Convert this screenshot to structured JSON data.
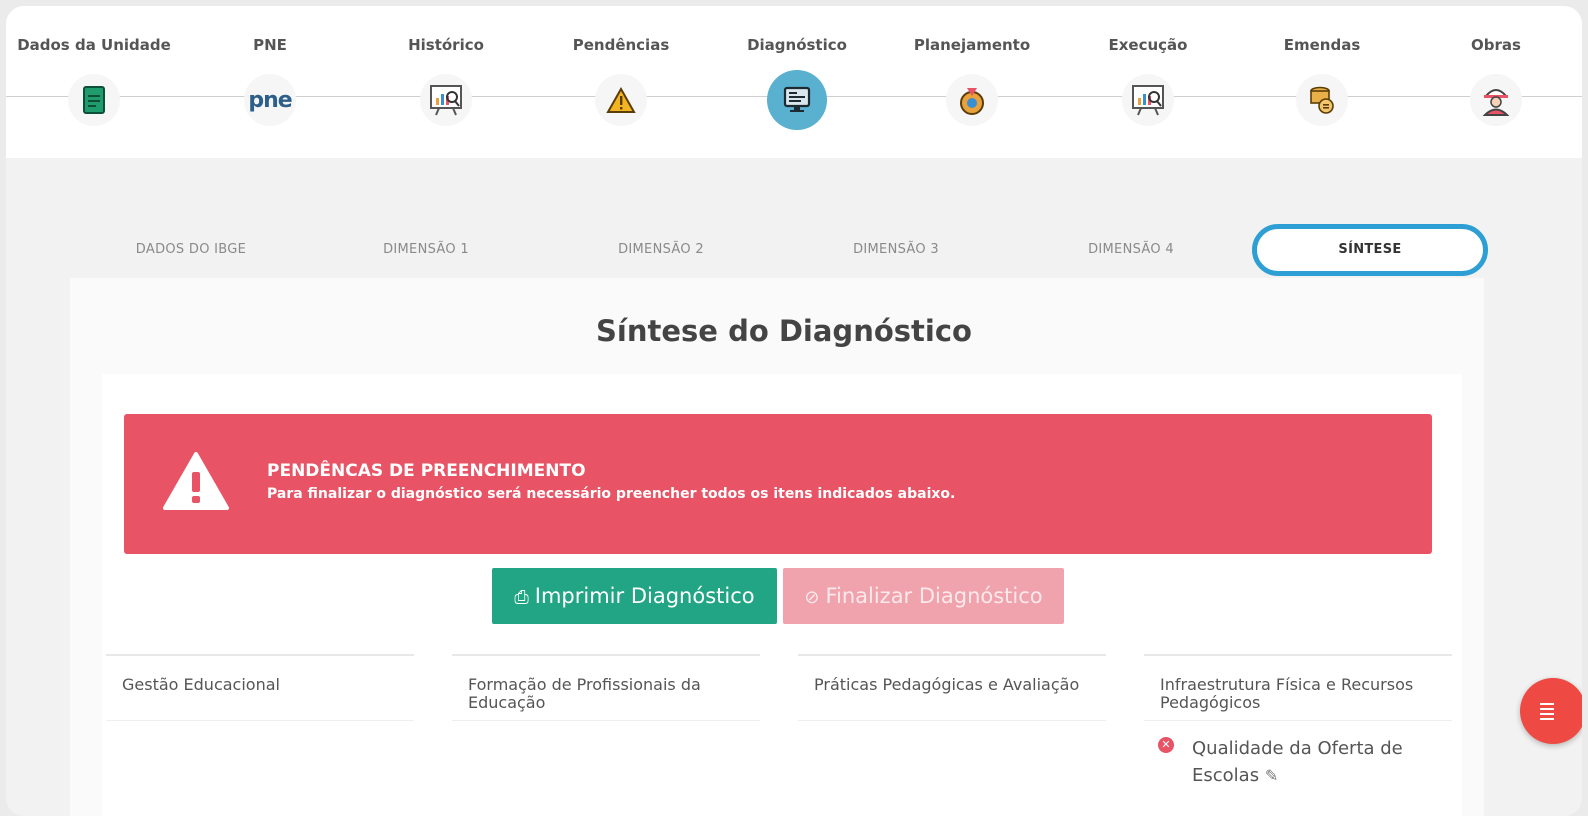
{
  "steps": [
    {
      "label": "Dados da Unidade",
      "icon": "document-icon"
    },
    {
      "label": "PNE",
      "icon": "pne-logo-icon"
    },
    {
      "label": "Histórico",
      "icon": "presentation-chart-icon"
    },
    {
      "label": "Pendências",
      "icon": "warning-icon"
    },
    {
      "label": "Diagnóstico",
      "icon": "monitor-icon"
    },
    {
      "label": "Planejamento",
      "icon": "planning-gear-icon"
    },
    {
      "label": "Execução",
      "icon": "presentation-chart-icon"
    },
    {
      "label": "Emendas",
      "icon": "coins-icon"
    },
    {
      "label": "Obras",
      "icon": "worker-icon"
    }
  ],
  "pne_text": "pne",
  "tabs": [
    "DADOS DO IBGE",
    "DIMENSÃO 1",
    "DIMENSÃO 2",
    "DIMENSÃO 3",
    "DIMENSÃO 4",
    "SÍNTESE"
  ],
  "active_tab": "SÍNTESE",
  "main": {
    "title": "Síntese do Diagnóstico",
    "alert": {
      "heading": "PENDÊNCAS DE PREENCHIMENTO",
      "message": "Para finalizar o diagnóstico será necessário preencher todos os itens indicados abaixo."
    },
    "print_button": "Imprimir Diagnóstico",
    "finalize_button": "Finalizar Diagnóstico",
    "columns": [
      {
        "heading": "Gestão Educacional",
        "items": []
      },
      {
        "heading": "Formação de Profissionais da Educação",
        "items": []
      },
      {
        "heading": "Práticas Pedagógicas e Avaliação",
        "items": []
      },
      {
        "heading": "Infraestrutura Física e Recursos Pedagógicos",
        "items": [
          "Qualidade da Oferta de Escolas"
        ]
      }
    ]
  },
  "colors": {
    "alert": "#e85466",
    "print": "#21a584",
    "finalize_disabled": "#f0a3ad",
    "active_tab_border": "#2e9fd4",
    "active_step": "#5ab0cf",
    "fab": "#ee4a43"
  }
}
